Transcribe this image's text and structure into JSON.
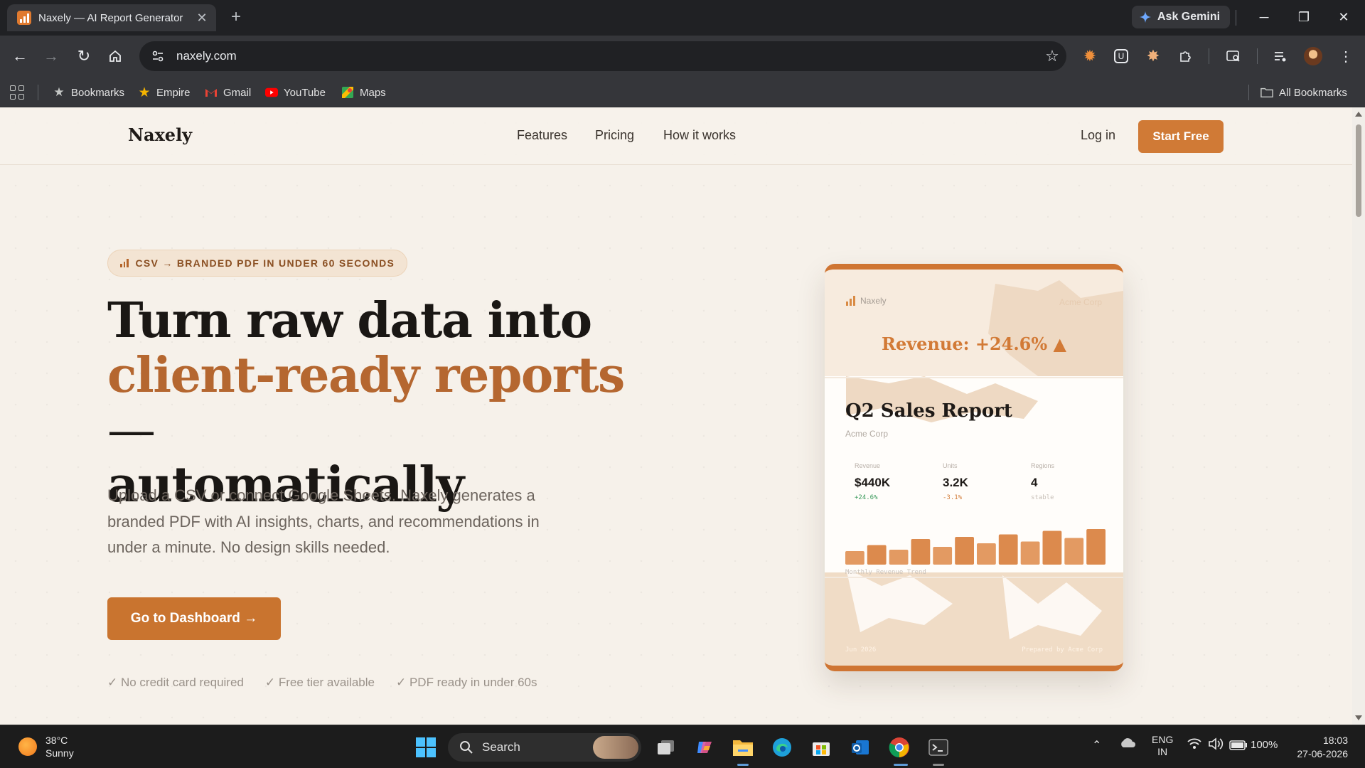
{
  "browser": {
    "tab_title": "Naxely — AI Report Generator",
    "ask_gemini": "Ask Gemini",
    "url": "naxely.com",
    "bookmarks": [
      {
        "label": "Bookmarks",
        "icon": "star-icon"
      },
      {
        "label": "Empire",
        "icon": "star-gold-icon"
      },
      {
        "label": "Gmail",
        "icon": "gmail-icon"
      },
      {
        "label": "YouTube",
        "icon": "youtube-icon"
      },
      {
        "label": "Maps",
        "icon": "maps-icon"
      }
    ],
    "all_bookmarks": "All Bookmarks"
  },
  "site": {
    "logo": "Naxely",
    "nav": [
      "Features",
      "Pricing",
      "How it works"
    ],
    "login": "Log in",
    "start_free": "Start Free",
    "accent": "#c9742f"
  },
  "hero": {
    "badge": "CSV → BRANDED PDF IN UNDER 60 SECONDS",
    "title_line1": "Turn raw data into",
    "title_accent": "client-ready reports",
    "title_dash": " —",
    "title_line3": "automatically",
    "subtitle": "Upload a CSV or connect Google Sheets. Naxely generates a branded PDF with AI insights, charts, and recommendations in under a minute. No design skills needed.",
    "cta": "Go to Dashboard →",
    "checks": [
      "✓ No credit card required",
      "✓ Free tier available",
      "✓ PDF ready in under 60s"
    ]
  },
  "report": {
    "brand": "Naxely",
    "client": "Acme Corp",
    "headline": "Revenue: +24.6% ▲",
    "title": "Q2 Sales Report",
    "subtitle": "Acme Corp",
    "metrics": [
      {
        "label": "Revenue",
        "value": "$440K",
        "delta": "+24.6%",
        "color": "#3a9a5b"
      },
      {
        "label": "Units",
        "value": "3.2K",
        "delta": "-3.1%",
        "color": "#d27a36"
      },
      {
        "label": "Regions",
        "value": "4",
        "delta": "stable",
        "color": "#c8c0b8"
      }
    ],
    "chart_label": "Monthly Revenue Trend",
    "bar_levels": [
      0.38,
      0.55,
      0.42,
      0.72,
      0.5,
      0.78,
      0.6,
      0.85,
      0.65,
      0.95,
      0.75,
      1.0
    ],
    "footer_left": "Jun 2026",
    "footer_right": "Prepared by Acme Corp"
  },
  "taskbar": {
    "temperature": "38°C",
    "condition": "Sunny",
    "search": "Search",
    "lang": "ENG",
    "region": "IN",
    "battery": "100%",
    "time": "18:03",
    "date": "27-06-2026"
  }
}
